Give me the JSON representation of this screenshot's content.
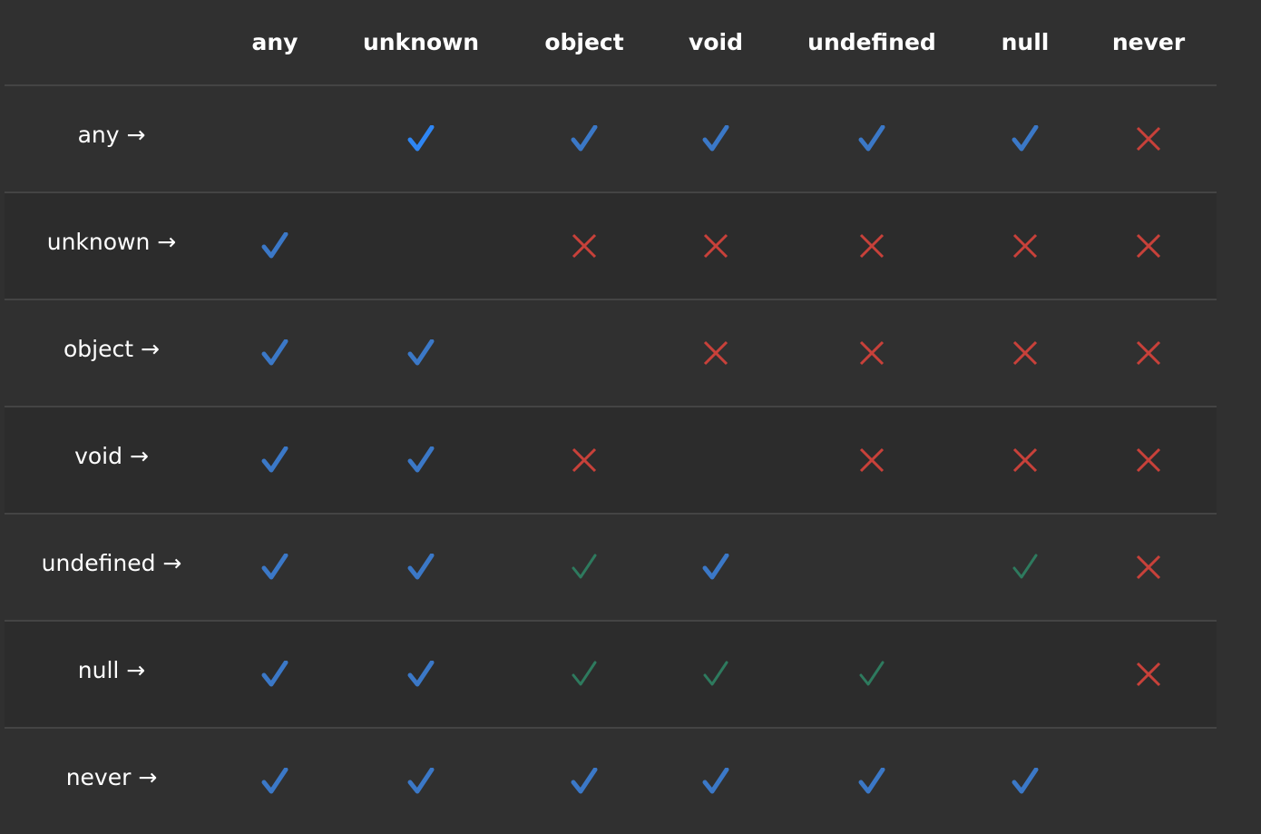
{
  "columns": [
    "any",
    "unknown",
    "object",
    "void",
    "undefined",
    "null",
    "never"
  ],
  "arrow": "→",
  "colors": {
    "check": "#3b78c7",
    "check_bright": "#2e86f4",
    "check_green": "#2e7a5e",
    "cross": "#c8413a",
    "background": "#303030",
    "row_alt": "#2c2c2c"
  },
  "rows": [
    {
      "label": "any",
      "cells": [
        "",
        "check_bright",
        "check",
        "check",
        "check",
        "check",
        "cross"
      ]
    },
    {
      "label": "unknown",
      "cells": [
        "check",
        "",
        "cross",
        "cross",
        "cross",
        "cross",
        "cross"
      ]
    },
    {
      "label": "object",
      "cells": [
        "check",
        "check",
        "",
        "cross",
        "cross",
        "cross",
        "cross"
      ]
    },
    {
      "label": "void",
      "cells": [
        "check",
        "check",
        "cross",
        "",
        "cross",
        "cross",
        "cross"
      ]
    },
    {
      "label": "undefined",
      "cells": [
        "check",
        "check",
        "check_green",
        "check",
        "",
        "check_green",
        "cross"
      ]
    },
    {
      "label": "null",
      "cells": [
        "check",
        "check",
        "check_green",
        "check_green",
        "check_green",
        "",
        "cross"
      ]
    },
    {
      "label": "never",
      "cells": [
        "check",
        "check",
        "check",
        "check",
        "check",
        "check",
        ""
      ]
    }
  ]
}
